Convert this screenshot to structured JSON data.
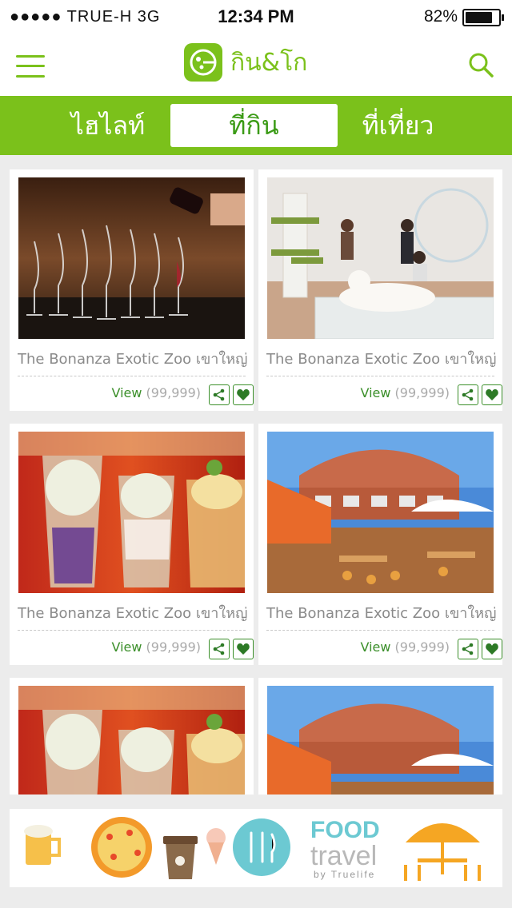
{
  "status_bar": {
    "signal": "●●●●● TRUE-H   3G",
    "time": "12:34 PM",
    "battery_pct": "82%",
    "battery_level": 0.82
  },
  "header": {
    "logo_text": "กิน&โก"
  },
  "tabs": [
    {
      "label": "ไฮไลท์",
      "active": false
    },
    {
      "label": "ที่กิน",
      "active": true
    },
    {
      "label": "ที่เที่ยว",
      "active": false
    }
  ],
  "cards": [
    {
      "title": "The Bonanza Exotic Zoo เขาใหญ่",
      "view_label": "View",
      "count": "(99,999)",
      "image": "wine-glasses-photo"
    },
    {
      "title": "The Bonanza Exotic Zoo เขาใหญ่",
      "view_label": "View",
      "count": "(99,999)",
      "image": "cat-cafe-photo"
    },
    {
      "title": "The Bonanza Exotic Zoo เขาใหญ่",
      "view_label": "View",
      "count": "(99,999)",
      "image": "ice-cream-glasses-photo"
    },
    {
      "title": "The Bonanza Exotic Zoo เขาใหญ่",
      "view_label": "View",
      "count": "(99,999)",
      "image": "outdoor-restaurant-photo"
    },
    {
      "title": "",
      "view_label": "",
      "count": "",
      "image": "ice-cream-glasses-photo"
    },
    {
      "title": "",
      "view_label": "",
      "count": "",
      "image": "outdoor-restaurant-photo"
    }
  ],
  "banner": {
    "food": "FOOD",
    "travel": "travel",
    "by": "by Truelife"
  },
  "colors": {
    "brand_green": "#7bc11b",
    "dark_green": "#3b8f2a",
    "banner_teal": "#6cc9d2",
    "banner_orange": "#f5a623"
  }
}
